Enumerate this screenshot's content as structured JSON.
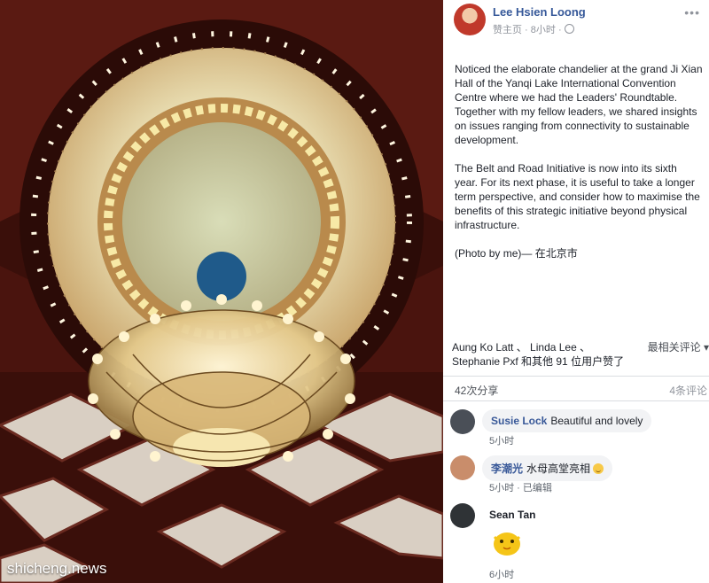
{
  "photo": {
    "watermark": "shicheng.news"
  },
  "post": {
    "author": "Lee Hsien Loong",
    "page_label": "赞主页",
    "time": "8小时",
    "more_icon": "ellipsis-icon",
    "paragraphs": [
      "Noticed the elaborate chandelier at the grand Ji Xian Hall of the Yanqi Lake International Convention Centre where we had the Leaders' Roundtable. Together with my fellow leaders, we shared insights on issues ranging from connectivity to sustainable development.",
      "The Belt and Road Initiative is now into its sixth year. For its next phase, it is useful to take a longer term perspective, and consider how to maximise the benefits of this strategic initiative beyond physical infrastructure.",
      "(Photo by me)— 在北京市"
    ],
    "reactions_text": "Aung Ko Latt 、 Linda Lee 、 Stephanie Pxf 和其他 91 位用户赞了",
    "sort_label": "最相关评论 ▾",
    "shares": "42次分享",
    "comments_count": "4条评论"
  },
  "comments": [
    {
      "name": "Susie Lock",
      "text": "Beautiful and lovely",
      "time": "5小时",
      "extra": ""
    },
    {
      "name": "李潮光",
      "text": "水母高堂亮相",
      "time": "5小时",
      "extra": "已编辑"
    },
    {
      "name": "Sean Tan",
      "text": "",
      "time": "6小时",
      "extra": ""
    }
  ],
  "colors": {
    "link_blue": "#365899",
    "comment_bg": "#f2f3f5",
    "muted": "#90949c"
  }
}
